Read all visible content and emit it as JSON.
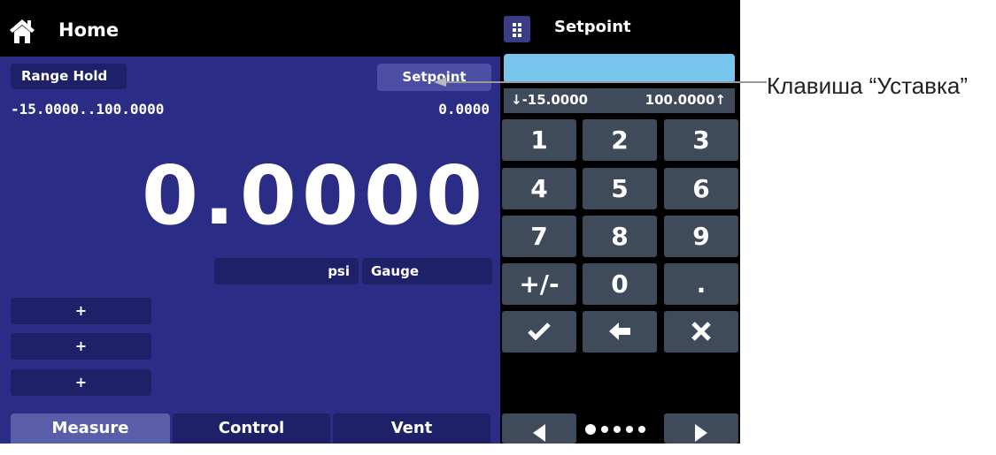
{
  "header": {
    "title": "Home"
  },
  "measure": {
    "range_hold_label": "Range Hold",
    "setpoint_label": "Setpoint",
    "range": "-15.0000..100.0000",
    "setpoint_value": "0.0000",
    "reading": "0.0000",
    "unit": "psi",
    "mode": "Gauge",
    "plus_buttons": [
      "+",
      "+",
      "+"
    ]
  },
  "tabs": [
    "Measure",
    "Control",
    "Vent"
  ],
  "keypad": {
    "title": "Setpoint",
    "entry_value": "",
    "min_limit": "↓-15.0000",
    "max_limit": "100.0000↑",
    "keys": [
      "1",
      "2",
      "3",
      "4",
      "5",
      "6",
      "7",
      "8",
      "9",
      "+/-",
      "0",
      "."
    ],
    "action_keys": [
      "✓",
      "🡐",
      "✕"
    ]
  },
  "callout": {
    "label": "Клавиша “Уставка”"
  },
  "colors": {
    "panel": "#2a2c86",
    "button": "#1e2068",
    "key": "#3f4a5a",
    "entry": "#78c6ee"
  }
}
